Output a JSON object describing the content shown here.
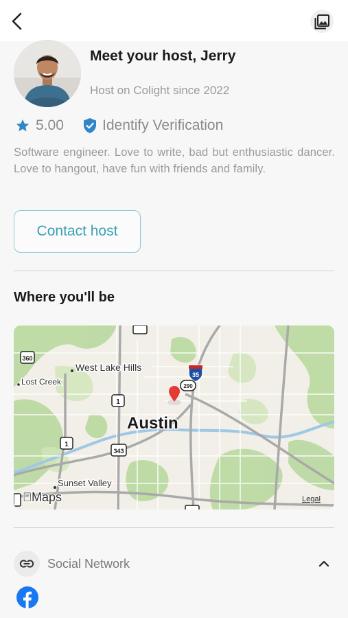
{
  "host": {
    "title": "Meet your host, Jerry",
    "since": "Host on Colight since 2022",
    "rating": "5.00",
    "verification": "Identify Verification",
    "bio": "Software engineer. Love to write, bad but enthusiastic dancer. Love to hangout, have fun with friends and family.",
    "contact_label": "Contact host"
  },
  "location": {
    "section_title": "Where you'll be",
    "map": {
      "city": "Austin",
      "places": [
        "West Lake Hills",
        "Lost Creek",
        "Sunset Valley"
      ],
      "shields": [
        "360",
        "1",
        "343",
        "35",
        "290"
      ],
      "attribution": "Maps",
      "legal": "Legal"
    }
  },
  "social": {
    "label": "Social Network",
    "networks": [
      "facebook"
    ]
  },
  "colors": {
    "accent": "#3aa0b7",
    "star": "#2f86c8",
    "pin": "#e53935",
    "facebook": "#1877f2"
  },
  "icons": [
    "back-arrow-icon",
    "gallery-icon",
    "star-icon",
    "verified-badge-icon",
    "link-icon",
    "chevron-up-icon",
    "facebook-icon",
    "map-pin-icon"
  ]
}
